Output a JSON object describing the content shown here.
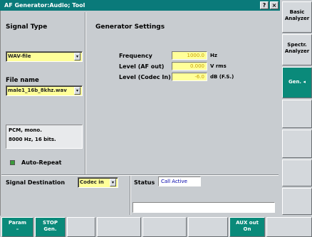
{
  "window": {
    "title": "AF Generator:Audio; Tool",
    "help_label": "?",
    "close_label": "×"
  },
  "signal_type": {
    "heading": "Signal Type",
    "type_value": "WAV-file",
    "file_name_label": "File name",
    "file_name_value": "male1_16b_8khz.wav",
    "info_line1": "PCM, mono.",
    "info_line2": "8000 Hz, 16 bits.",
    "auto_repeat_label": "Auto-Repeat"
  },
  "generator_settings": {
    "heading": "Generator Settings",
    "rows": [
      {
        "label": "Frequency",
        "value": "1000.0",
        "unit": "Hz"
      },
      {
        "label": "Level (AF out)",
        "value": "0.000",
        "unit": "V rms"
      },
      {
        "label": "Level (Codec In)",
        "value": "-6.0",
        "unit": "dB (F.S.)"
      }
    ]
  },
  "bottom_panel": {
    "signal_destination_label": "Signal Destination",
    "signal_destination_value": "Codec in",
    "status_label": "Status",
    "status_value": "Call Active"
  },
  "right_softkeys": [
    {
      "label": "Basic\nAnalyzer",
      "active": false
    },
    {
      "label": "Spectr.\nAnalyzer",
      "active": false
    },
    {
      "label": "Gen. ◂",
      "active": true
    },
    {
      "label": "",
      "active": false
    },
    {
      "label": "",
      "active": false
    },
    {
      "label": "",
      "active": false
    },
    {
      "label": "",
      "active": false
    }
  ],
  "bottom_softkeys": [
    {
      "label": "Param\n–",
      "active": true
    },
    {
      "label": "STOP\nGen.",
      "active": true
    },
    {
      "label": "",
      "active": false
    },
    {
      "label": "",
      "active": false
    },
    {
      "label": "",
      "active": false
    },
    {
      "label": "",
      "active": false
    },
    {
      "label": "AUX out\nOn",
      "active": true
    },
    {
      "label": "",
      "active": false
    }
  ],
  "colors": {
    "title_bg": "#0a7a7a",
    "active_key": "#0a8a7a",
    "input_bg": "#ffff99",
    "status_text": "#0000aa",
    "led_green": "#3a9a3a"
  }
}
